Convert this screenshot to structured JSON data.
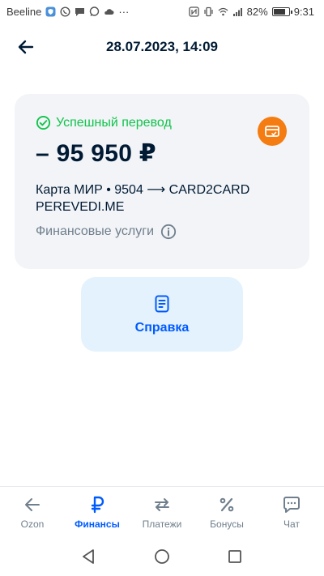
{
  "status_bar": {
    "carrier": "Beeline",
    "more": "···",
    "battery": "82%",
    "battery_level": 0.82,
    "time": "9:31"
  },
  "header": {
    "title": "28.07.2023, 14:09",
    "back_icon": "arrow-left-icon"
  },
  "transfer": {
    "status": "Успешный перевод",
    "status_color": "#10c44c",
    "amount": "– 95 950 ₽",
    "route": "Карта МИР • 9504 ⟶ CARD2CARD PEREVEDI.ME",
    "category": "Финансовые услуги",
    "badge_icon": "card-check-icon",
    "badge_color": "#f57c10"
  },
  "help_button": {
    "label": "Справка",
    "icon": "document-icon"
  },
  "bottom_nav": {
    "items": [
      {
        "label": "Ozon",
        "icon": "arrow-left-icon"
      },
      {
        "label": "Финансы",
        "icon": "ruble-icon",
        "active": true
      },
      {
        "label": "Платежи",
        "icon": "transfer-arrows-icon"
      },
      {
        "label": "Бонусы",
        "icon": "percent-icon"
      },
      {
        "label": "Чат",
        "icon": "chat-bubble-icon"
      }
    ]
  },
  "accent_color": "#005bff"
}
